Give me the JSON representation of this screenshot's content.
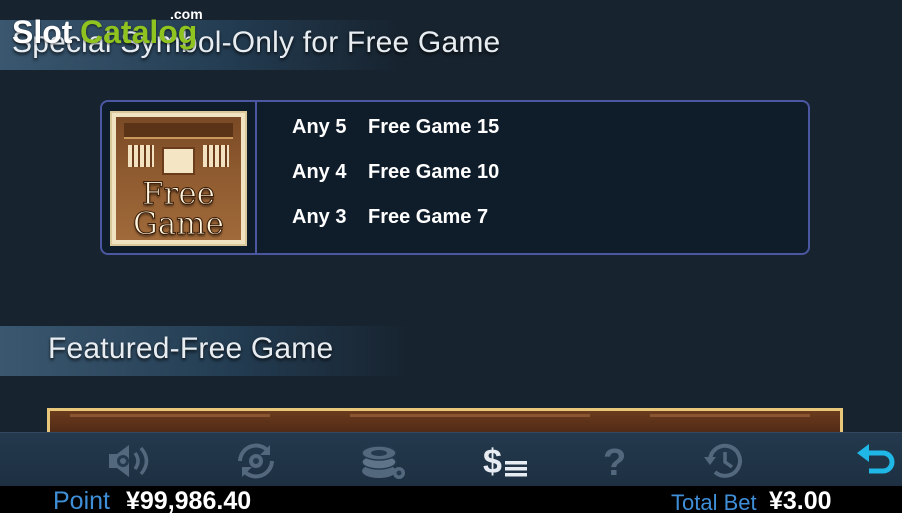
{
  "watermark": {
    "slot": "Slot",
    "catalog": "Catalog",
    "com": ".com"
  },
  "sections": {
    "special": {
      "title": "Special Symbol-Only for Free Game"
    },
    "featured": {
      "title": "Featured-Free Game"
    }
  },
  "symbol": {
    "line1": "Free",
    "line2": "Game"
  },
  "paytable": [
    {
      "count": "Any 5",
      "reward": "Free Game 15"
    },
    {
      "count": "Any 4",
      "reward": "Free Game 10"
    },
    {
      "count": "Any 3",
      "reward": "Free Game 7"
    }
  ],
  "toolbar": {
    "icons": [
      "sound-icon",
      "autoplay-icon",
      "chips-icon",
      "paytable-icon",
      "help-icon",
      "history-icon",
      "back-icon"
    ],
    "active": "paytable-icon"
  },
  "status": {
    "point_label": "Point",
    "point_value": "¥99,986.40",
    "bet_label": "Total Bet",
    "bet_value": "¥3.00"
  },
  "colors": {
    "background": "#17232f",
    "accent_blue": "#3f8fd8",
    "box_border": "#4b57a0",
    "back_icon": "#1fb7e6",
    "icon_inactive": "#53687d"
  }
}
